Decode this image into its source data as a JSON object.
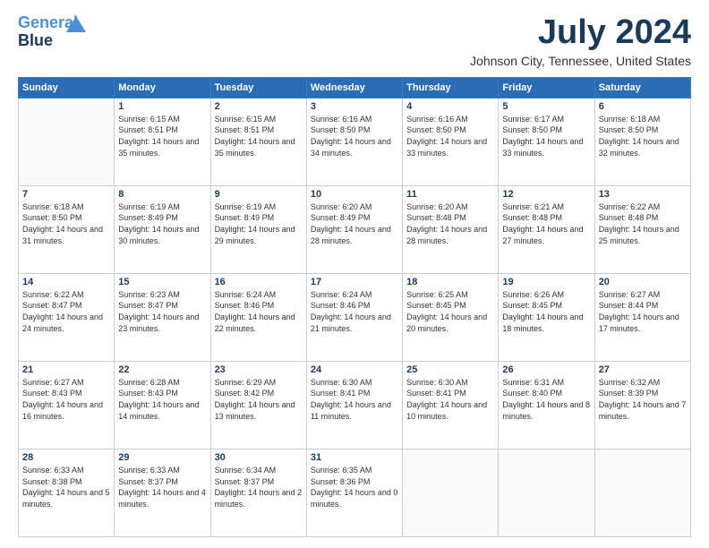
{
  "header": {
    "logo_line1": "General",
    "logo_line2": "Blue",
    "month_year": "July 2024",
    "location": "Johnson City, Tennessee, United States"
  },
  "weekdays": [
    "Sunday",
    "Monday",
    "Tuesday",
    "Wednesday",
    "Thursday",
    "Friday",
    "Saturday"
  ],
  "weeks": [
    [
      {
        "day": "",
        "sunrise": "",
        "sunset": "",
        "daylight": ""
      },
      {
        "day": "1",
        "sunrise": "Sunrise: 6:15 AM",
        "sunset": "Sunset: 8:51 PM",
        "daylight": "Daylight: 14 hours and 35 minutes."
      },
      {
        "day": "2",
        "sunrise": "Sunrise: 6:15 AM",
        "sunset": "Sunset: 8:51 PM",
        "daylight": "Daylight: 14 hours and 35 minutes."
      },
      {
        "day": "3",
        "sunrise": "Sunrise: 6:16 AM",
        "sunset": "Sunset: 8:50 PM",
        "daylight": "Daylight: 14 hours and 34 minutes."
      },
      {
        "day": "4",
        "sunrise": "Sunrise: 6:16 AM",
        "sunset": "Sunset: 8:50 PM",
        "daylight": "Daylight: 14 hours and 33 minutes."
      },
      {
        "day": "5",
        "sunrise": "Sunrise: 6:17 AM",
        "sunset": "Sunset: 8:50 PM",
        "daylight": "Daylight: 14 hours and 33 minutes."
      },
      {
        "day": "6",
        "sunrise": "Sunrise: 6:18 AM",
        "sunset": "Sunset: 8:50 PM",
        "daylight": "Daylight: 14 hours and 32 minutes."
      }
    ],
    [
      {
        "day": "7",
        "sunrise": "Sunrise: 6:18 AM",
        "sunset": "Sunset: 8:50 PM",
        "daylight": "Daylight: 14 hours and 31 minutes."
      },
      {
        "day": "8",
        "sunrise": "Sunrise: 6:19 AM",
        "sunset": "Sunset: 8:49 PM",
        "daylight": "Daylight: 14 hours and 30 minutes."
      },
      {
        "day": "9",
        "sunrise": "Sunrise: 6:19 AM",
        "sunset": "Sunset: 8:49 PM",
        "daylight": "Daylight: 14 hours and 29 minutes."
      },
      {
        "day": "10",
        "sunrise": "Sunrise: 6:20 AM",
        "sunset": "Sunset: 8:49 PM",
        "daylight": "Daylight: 14 hours and 28 minutes."
      },
      {
        "day": "11",
        "sunrise": "Sunrise: 6:20 AM",
        "sunset": "Sunset: 8:48 PM",
        "daylight": "Daylight: 14 hours and 28 minutes."
      },
      {
        "day": "12",
        "sunrise": "Sunrise: 6:21 AM",
        "sunset": "Sunset: 8:48 PM",
        "daylight": "Daylight: 14 hours and 27 minutes."
      },
      {
        "day": "13",
        "sunrise": "Sunrise: 6:22 AM",
        "sunset": "Sunset: 8:48 PM",
        "daylight": "Daylight: 14 hours and 25 minutes."
      }
    ],
    [
      {
        "day": "14",
        "sunrise": "Sunrise: 6:22 AM",
        "sunset": "Sunset: 8:47 PM",
        "daylight": "Daylight: 14 hours and 24 minutes."
      },
      {
        "day": "15",
        "sunrise": "Sunrise: 6:23 AM",
        "sunset": "Sunset: 8:47 PM",
        "daylight": "Daylight: 14 hours and 23 minutes."
      },
      {
        "day": "16",
        "sunrise": "Sunrise: 6:24 AM",
        "sunset": "Sunset: 8:46 PM",
        "daylight": "Daylight: 14 hours and 22 minutes."
      },
      {
        "day": "17",
        "sunrise": "Sunrise: 6:24 AM",
        "sunset": "Sunset: 8:46 PM",
        "daylight": "Daylight: 14 hours and 21 minutes."
      },
      {
        "day": "18",
        "sunrise": "Sunrise: 6:25 AM",
        "sunset": "Sunset: 8:45 PM",
        "daylight": "Daylight: 14 hours and 20 minutes."
      },
      {
        "day": "19",
        "sunrise": "Sunrise: 6:26 AM",
        "sunset": "Sunset: 8:45 PM",
        "daylight": "Daylight: 14 hours and 18 minutes."
      },
      {
        "day": "20",
        "sunrise": "Sunrise: 6:27 AM",
        "sunset": "Sunset: 8:44 PM",
        "daylight": "Daylight: 14 hours and 17 minutes."
      }
    ],
    [
      {
        "day": "21",
        "sunrise": "Sunrise: 6:27 AM",
        "sunset": "Sunset: 8:43 PM",
        "daylight": "Daylight: 14 hours and 16 minutes."
      },
      {
        "day": "22",
        "sunrise": "Sunrise: 6:28 AM",
        "sunset": "Sunset: 8:43 PM",
        "daylight": "Daylight: 14 hours and 14 minutes."
      },
      {
        "day": "23",
        "sunrise": "Sunrise: 6:29 AM",
        "sunset": "Sunset: 8:42 PM",
        "daylight": "Daylight: 14 hours and 13 minutes."
      },
      {
        "day": "24",
        "sunrise": "Sunrise: 6:30 AM",
        "sunset": "Sunset: 8:41 PM",
        "daylight": "Daylight: 14 hours and 11 minutes."
      },
      {
        "day": "25",
        "sunrise": "Sunrise: 6:30 AM",
        "sunset": "Sunset: 8:41 PM",
        "daylight": "Daylight: 14 hours and 10 minutes."
      },
      {
        "day": "26",
        "sunrise": "Sunrise: 6:31 AM",
        "sunset": "Sunset: 8:40 PM",
        "daylight": "Daylight: 14 hours and 8 minutes."
      },
      {
        "day": "27",
        "sunrise": "Sunrise: 6:32 AM",
        "sunset": "Sunset: 8:39 PM",
        "daylight": "Daylight: 14 hours and 7 minutes."
      }
    ],
    [
      {
        "day": "28",
        "sunrise": "Sunrise: 6:33 AM",
        "sunset": "Sunset: 8:38 PM",
        "daylight": "Daylight: 14 hours and 5 minutes."
      },
      {
        "day": "29",
        "sunrise": "Sunrise: 6:33 AM",
        "sunset": "Sunset: 8:37 PM",
        "daylight": "Daylight: 14 hours and 4 minutes."
      },
      {
        "day": "30",
        "sunrise": "Sunrise: 6:34 AM",
        "sunset": "Sunset: 8:37 PM",
        "daylight": "Daylight: 14 hours and 2 minutes."
      },
      {
        "day": "31",
        "sunrise": "Sunrise: 6:35 AM",
        "sunset": "Sunset: 8:36 PM",
        "daylight": "Daylight: 14 hours and 0 minutes."
      },
      {
        "day": "",
        "sunrise": "",
        "sunset": "",
        "daylight": ""
      },
      {
        "day": "",
        "sunrise": "",
        "sunset": "",
        "daylight": ""
      },
      {
        "day": "",
        "sunrise": "",
        "sunset": "",
        "daylight": ""
      }
    ]
  ]
}
